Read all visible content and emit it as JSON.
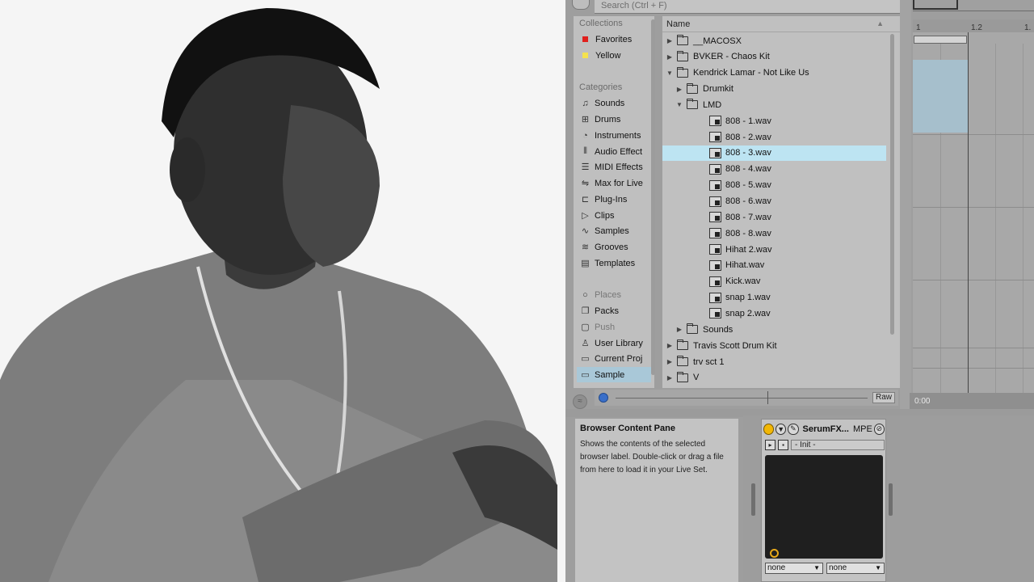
{
  "search": {
    "placeholder": "Search (Ctrl + F)"
  },
  "sidebar": {
    "collections_title": "Collections",
    "collections": [
      {
        "label": "Favorites",
        "color": "#e0201d"
      },
      {
        "label": "Yellow",
        "color": "#f4e24e"
      }
    ],
    "categories_title": "Categories",
    "categories": [
      {
        "label": "Sounds",
        "icon": "music-note-icon"
      },
      {
        "label": "Drums",
        "icon": "drum-grid-icon"
      },
      {
        "label": "Instruments",
        "icon": "instrument-clock-icon"
      },
      {
        "label": "Audio Effect",
        "icon": "audio-wave-icon"
      },
      {
        "label": "MIDI Effects",
        "icon": "midi-icon"
      },
      {
        "label": "Max for Live",
        "icon": "max-icon"
      },
      {
        "label": "Plug-Ins",
        "icon": "plug-icon"
      },
      {
        "label": "Clips",
        "icon": "clip-icon"
      },
      {
        "label": "Samples",
        "icon": "sample-wave-icon"
      },
      {
        "label": "Grooves",
        "icon": "groove-icon"
      },
      {
        "label": "Templates",
        "icon": "template-icon"
      }
    ],
    "places_title": "Places",
    "places": [
      {
        "label": "Packs",
        "icon": "packs-icon"
      },
      {
        "label": "Push",
        "icon": "push-icon"
      },
      {
        "label": "User Library",
        "icon": "user-library-icon"
      },
      {
        "label": "Current Proj",
        "icon": "current-project-icon"
      },
      {
        "label": "Sample",
        "icon": "folder-icon"
      }
    ]
  },
  "filelist": {
    "header": "Name",
    "rows": [
      {
        "label": "__MACOSX",
        "kind": "folder",
        "depth": 0,
        "expanded": false
      },
      {
        "label": "BVKER - Chaos Kit",
        "kind": "folder",
        "depth": 0,
        "expanded": false
      },
      {
        "label": "Kendrick Lamar - Not Like Us",
        "kind": "folder",
        "depth": 0,
        "expanded": true
      },
      {
        "label": "Drumkit",
        "kind": "folder",
        "depth": 1,
        "expanded": false
      },
      {
        "label": "LMD",
        "kind": "folder",
        "depth": 1,
        "expanded": true
      },
      {
        "label": "808 - 1.wav",
        "kind": "file",
        "depth": 2
      },
      {
        "label": "808 - 2.wav",
        "kind": "file",
        "depth": 2
      },
      {
        "label": "808 - 3.wav",
        "kind": "file",
        "depth": 2,
        "selected": true
      },
      {
        "label": "808 - 4.wav",
        "kind": "file",
        "depth": 2
      },
      {
        "label": "808 - 5.wav",
        "kind": "file",
        "depth": 2
      },
      {
        "label": "808 - 6.wav",
        "kind": "file",
        "depth": 2
      },
      {
        "label": "808 - 7.wav",
        "kind": "file",
        "depth": 2
      },
      {
        "label": "808 - 8.wav",
        "kind": "file",
        "depth": 2
      },
      {
        "label": "Hihat 2.wav",
        "kind": "file",
        "depth": 2
      },
      {
        "label": "Hihat.wav",
        "kind": "file",
        "depth": 2
      },
      {
        "label": "Kick.wav",
        "kind": "file",
        "depth": 2
      },
      {
        "label": "snap 1.wav",
        "kind": "file",
        "depth": 2
      },
      {
        "label": "snap 2.wav",
        "kind": "file",
        "depth": 2
      },
      {
        "label": "Sounds",
        "kind": "folder",
        "depth": 1,
        "expanded": false
      },
      {
        "label": "Travis Scott Drum Kit",
        "kind": "folder",
        "depth": 0,
        "expanded": false
      },
      {
        "label": "trv sct 1",
        "kind": "folder",
        "depth": 0,
        "expanded": false
      },
      {
        "label": "V",
        "kind": "folder",
        "depth": 0,
        "expanded": false
      }
    ]
  },
  "preview": {
    "raw_label": "Raw"
  },
  "arrangement": {
    "ruler": [
      "1",
      "1.2",
      "1."
    ],
    "time": "0:00"
  },
  "info": {
    "title": "Browser Content Pane",
    "body": "Shows the contents of the selected browser label. Double-click or drag a file from here to load it in your Live Set."
  },
  "device": {
    "title": "SerumFX...",
    "mpe": "MPE",
    "preset": "- Init -",
    "select_left": "none",
    "select_right": "none"
  }
}
